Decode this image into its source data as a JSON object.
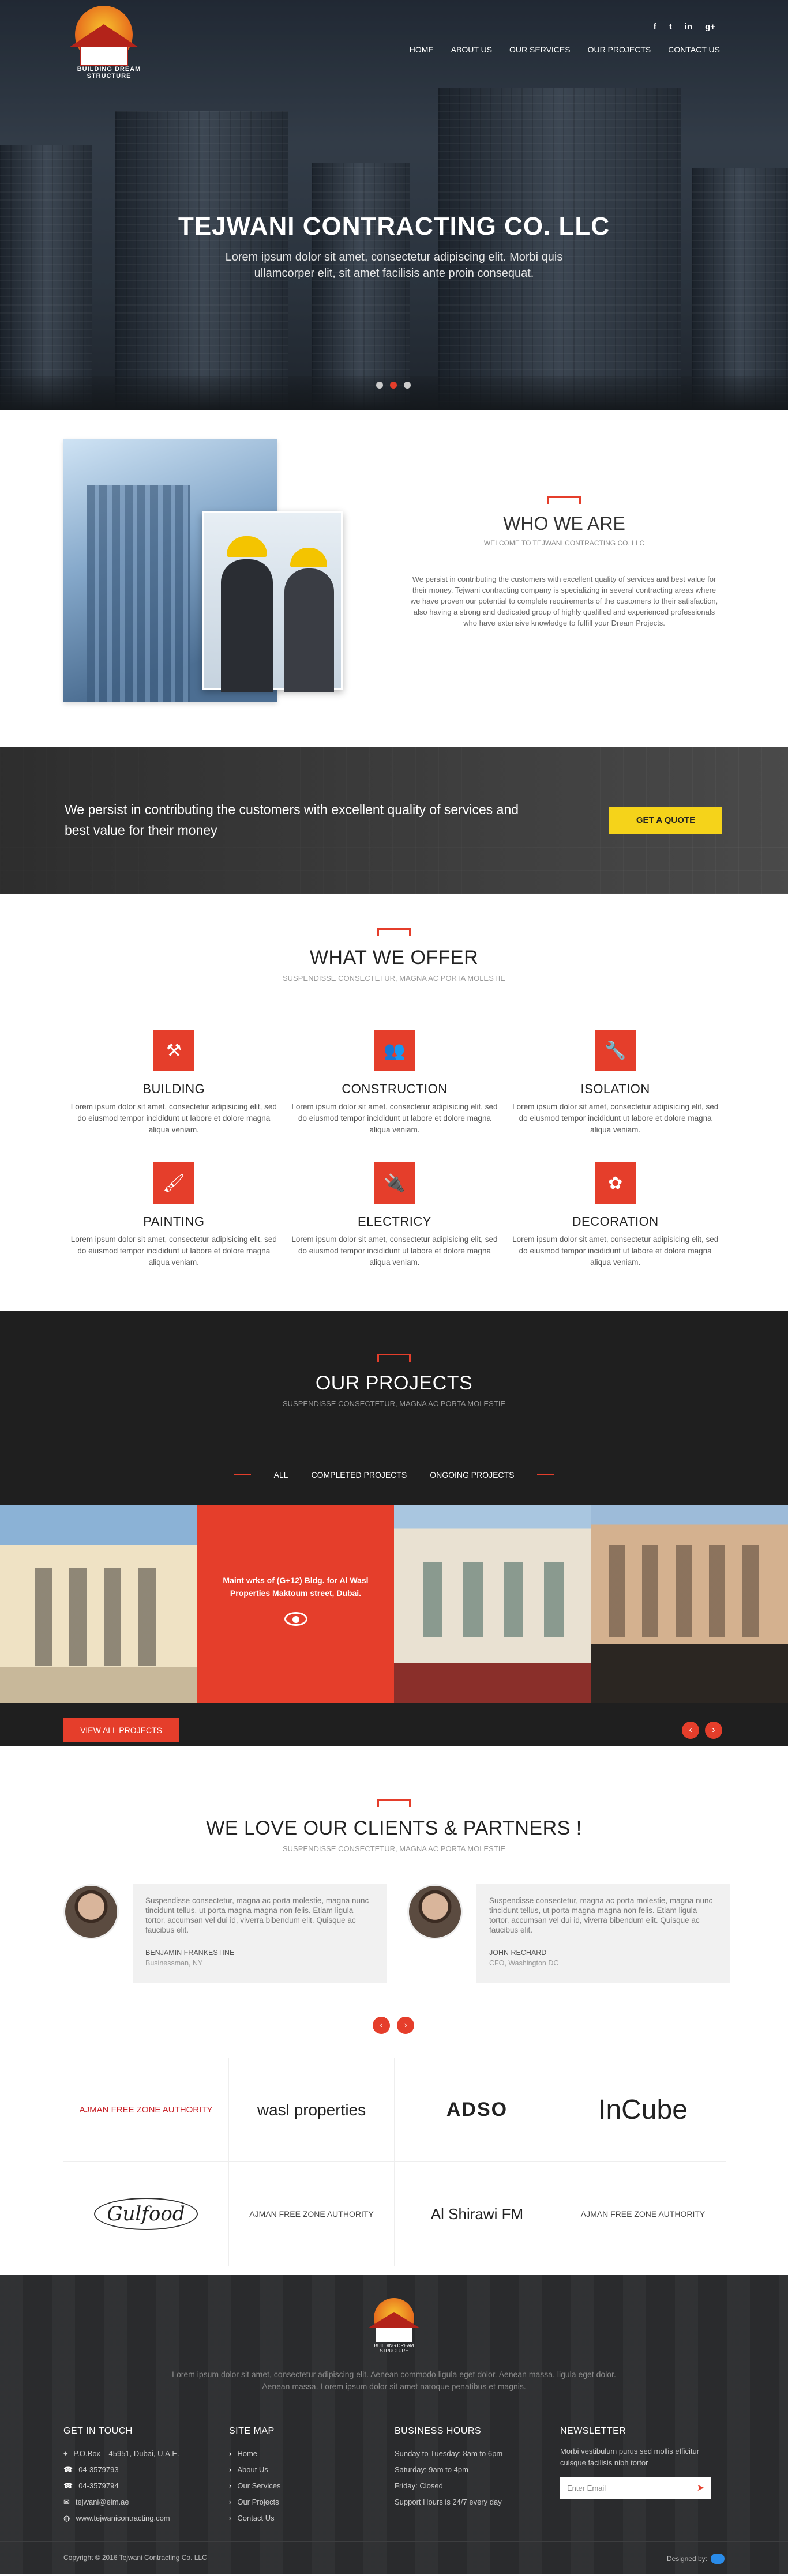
{
  "brand": {
    "logo_text": "BUILDING DREAM STRUCTURE"
  },
  "social": [
    "f",
    "t",
    "in",
    "g+"
  ],
  "nav": [
    "HOME",
    "ABOUT US",
    "OUR SERVICES",
    "OUR PROJECTS",
    "CONTACT US"
  ],
  "hero": {
    "title": "TEJWANI CONTRACTING CO. LLC",
    "subtitle": "Lorem ipsum dolor sit amet, consectetur adipiscing elit. Morbi quis ullamcorper elit, sit amet facilisis ante proin consequat.",
    "slides": 3,
    "active_slide": 2
  },
  "who": {
    "title": "WHO WE ARE",
    "subtitle": "WELCOME TO TEJWANI CONTRACTING CO. LLC",
    "body": "We persist in contributing the customers with excellent quality of services and best value for their money. Tejwani contracting company is specializing in several contracting areas where we have proven our potential to complete requirements of the customers to their satisfaction, also having a strong and dedicated group of highly qualified and experienced professionals who have extensive knowledge to fulfill your Dream Projects."
  },
  "quote": {
    "text": "We persist in contributing the customers with excellent quality of services and best value for their money",
    "button": "GET A QUOTE"
  },
  "offer": {
    "title": "WHAT WE OFFER",
    "subtitle": "SUSPENDISSE CONSECTETUR, MAGNA AC PORTA MOLESTIE",
    "services": [
      {
        "icon": "hammer-icon",
        "glyph": "⚒",
        "title": "BUILDING",
        "text": "Lorem ipsum dolor sit amet, consectetur adipisicing elit, sed do eiusmod tempor incididunt ut labore et dolore magna aliqua veniam."
      },
      {
        "icon": "workers-icon",
        "glyph": "👥",
        "title": "CONSTRUCTION",
        "text": "Lorem ipsum dolor sit amet, consectetur adipisicing elit, sed do eiusmod tempor incididunt ut labore et dolore magna aliqua veniam."
      },
      {
        "icon": "drill-icon",
        "glyph": "🔧",
        "title": "ISOLATION",
        "text": "Lorem ipsum dolor sit amet, consectetur adipisicing elit, sed do eiusmod tempor incididunt ut labore et dolore magna aliqua veniam."
      },
      {
        "icon": "paint-roller-icon",
        "glyph": "🖌",
        "title": "PAINTING",
        "text": "Lorem ipsum dolor sit amet, consectetur adipisicing elit, sed do eiusmod tempor incididunt ut labore et dolore magna aliqua veniam."
      },
      {
        "icon": "plug-icon",
        "glyph": "🔌",
        "title": "ELECTRICY",
        "text": "Lorem ipsum dolor sit amet, consectetur adipisicing elit, sed do eiusmod tempor incididunt ut labore et dolore magna aliqua veniam."
      },
      {
        "icon": "flower-icon",
        "glyph": "✿",
        "title": "DECORATION",
        "text": "Lorem ipsum dolor sit amet, consectetur adipisicing elit, sed do eiusmod tempor incididunt ut labore et dolore magna aliqua veniam."
      }
    ]
  },
  "projects": {
    "title": "OUR PROJECTS",
    "subtitle": "SUSPENDISSE CONSECTETUR, MAGNA AC PORTA MOLESTIE",
    "filters": [
      "ALL",
      "COMPLETED PROJECTS",
      "ONGOING PROJECTS"
    ],
    "hover_caption": "Maint wrks of (G+12) Bldg. for Al Wasl Properties Maktoum street, Dubai.",
    "view_all": "VIEW ALL PROJECTS",
    "prev": "‹",
    "next": "›"
  },
  "clients": {
    "title": "WE LOVE OUR CLIENTS & PARTNERS !",
    "subtitle": "SUSPENDISSE CONSECTETUR, MAGNA AC PORTA MOLESTIE",
    "testimonials": [
      {
        "text": "Suspendisse consectetur, magna ac porta molestie, magna nunc tincidunt tellus, ut porta magna magna non felis. Etiam ligula tortor, accumsan vel dui id, viverra bibendum elit. Quisque ac faucibus elit.",
        "name": "BENJAMIN FRANKESTINE",
        "role": "Businessman, NY"
      },
      {
        "text": "Suspendisse consectetur, magna ac porta molestie, magna nunc tincidunt tellus, ut porta magna magna non felis. Etiam ligula tortor, accumsan vel dui id, viverra bibendum elit. Quisque ac faucibus elit.",
        "name": "JOHN RECHARD",
        "role": "CFO, Washington DC"
      }
    ],
    "prev": "‹",
    "next": "›",
    "logos": [
      {
        "name": "ajman-free-zone-logo",
        "text": "AJMAN FREE ZONE AUTHORITY",
        "style": "red"
      },
      {
        "name": "wasl-properties-logo",
        "text": "wasl properties",
        "style": "wasl"
      },
      {
        "name": "adso-logo",
        "text": "ADSO",
        "style": "adso"
      },
      {
        "name": "incube-logo",
        "text": "InCube",
        "style": "big"
      },
      {
        "name": "gulfood-logo",
        "text": "Gulfood",
        "style": "serif"
      },
      {
        "name": "ajman-free-zone-logo-2",
        "text": "AJMAN FREE ZONE AUTHORITY",
        "style": "ajm2"
      },
      {
        "name": "al-shirawi-fm-logo",
        "text": "Al Shirawi FM",
        "style": "fm"
      },
      {
        "name": "ajman-free-zone-logo-3",
        "text": "AJMAN FREE ZONE AUTHORITY",
        "style": "ajm2"
      }
    ]
  },
  "footer": {
    "intro": "Lorem ipsum dolor sit amet, consectetur adipiscing elit. Aenean commodo ligula eget dolor. Aenean massa. ligula eget dolor. Aenean massa. Lorem ipsum dolor sit amet natoque penatibus et magnis.",
    "get_in_touch": {
      "title": "GET IN TOUCH",
      "items": [
        "P.O.Box – 45951, Dubai, U.A.E.",
        "04-3579793",
        "04-3579794",
        "tejwani@eim.ae",
        "www.tejwanicontracting.com"
      ]
    },
    "site_map": {
      "title": "SITE MAP",
      "items": [
        "Home",
        "About Us",
        "Our Services",
        "Our Projects",
        "Contact Us"
      ]
    },
    "hours": {
      "title": "BUSINESS HOURS",
      "items": [
        "Sunday to Tuesday: 8am to 6pm",
        "Saturday: 9am to 4pm",
        "Friday: Closed",
        "Support Hours is 24/7 every day"
      ]
    },
    "newsletter": {
      "title": "NEWSLETTER",
      "text": "Morbi vestibulum purus sed mollis efficitur cuisque facilisis nibh tortor",
      "placeholder": "Enter Email"
    },
    "copyright": "Copyright © 2016 Tejwani Contracting Co. LLC",
    "designed_by": "Designed by:"
  },
  "colors": {
    "accent": "#e53e2b",
    "quote_button": "#f5d31a",
    "dark": "#1f1f1f"
  }
}
